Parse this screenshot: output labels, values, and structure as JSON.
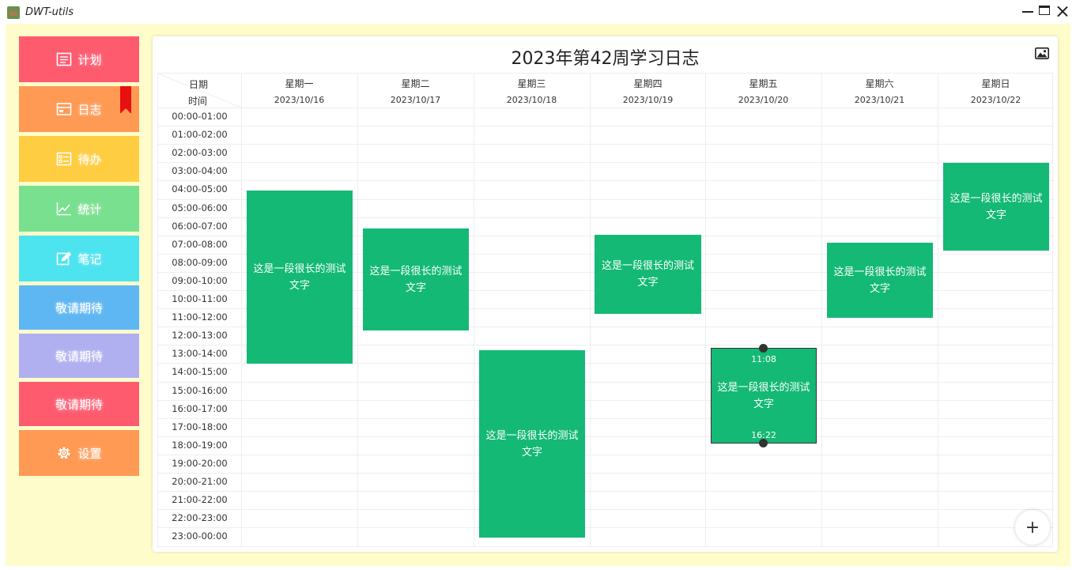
{
  "window": {
    "title": "DWT-utils"
  },
  "sidebar": {
    "items": [
      {
        "label": "计划",
        "icon": "list-icon",
        "color": "#fe5b6f"
      },
      {
        "label": "日志",
        "icon": "calendar-card-icon",
        "color": "#ff9a55"
      },
      {
        "label": "待办",
        "icon": "checklist-icon",
        "color": "#ffcd41"
      },
      {
        "label": "统计",
        "icon": "chart-line-icon",
        "color": "#78e08f"
      },
      {
        "label": "笔记",
        "icon": "edit-icon",
        "color": "#4de4ef"
      },
      {
        "label": "敬请期待",
        "icon": "",
        "color": "#5eb6f2"
      },
      {
        "label": "敬请期待",
        "icon": "",
        "color": "#b0aff0"
      },
      {
        "label": "敬请期待",
        "icon": "",
        "color": "#fe5b6f"
      },
      {
        "label": "设置",
        "icon": "gear-icon",
        "color": "#ff9a55"
      }
    ]
  },
  "journal": {
    "title": "2023年第42周学习日志",
    "header": {
      "date_label": "日期",
      "time_label": "时间"
    },
    "days": [
      {
        "name": "星期一",
        "date": "2023/10/16"
      },
      {
        "name": "星期二",
        "date": "2023/10/17"
      },
      {
        "name": "星期三",
        "date": "2023/10/18"
      },
      {
        "name": "星期四",
        "date": "2023/10/19"
      },
      {
        "name": "星期五",
        "date": "2023/10/20"
      },
      {
        "name": "星期六",
        "date": "2023/10/21"
      },
      {
        "name": "星期日",
        "date": "2023/10/22"
      }
    ],
    "slots": [
      "00:00-01:00",
      "01:00-02:00",
      "02:00-03:00",
      "03:00-04:00",
      "04:00-05:00",
      "05:00-06:00",
      "06:00-07:00",
      "07:00-08:00",
      "08:00-09:00",
      "09:00-10:00",
      "10:00-11:00",
      "11:00-12:00",
      "12:00-13:00",
      "13:00-14:00",
      "14:00-15:00",
      "15:00-16:00",
      "16:00-17:00",
      "17:00-18:00",
      "18:00-19:00",
      "19:00-20:00",
      "20:00-21:00",
      "21:00-22:00",
      "22:00-23:00",
      "23:00-00:00"
    ],
    "events": [
      {
        "text": "这是一段很长的测试文字"
      },
      {
        "text": "这是一段很长的测试文字"
      },
      {
        "text": "这是一段很长的测试文字"
      },
      {
        "text": "这是一段很长的测试文字"
      },
      {
        "text": "这是一段很长的测试文字",
        "start_label": "11:08",
        "end_label": "16:22"
      },
      {
        "text": "这是一段很长的测试文字"
      },
      {
        "text": "这是一段很长的测试文字"
      }
    ],
    "event_color": "#14b975",
    "add_label": "+"
  }
}
